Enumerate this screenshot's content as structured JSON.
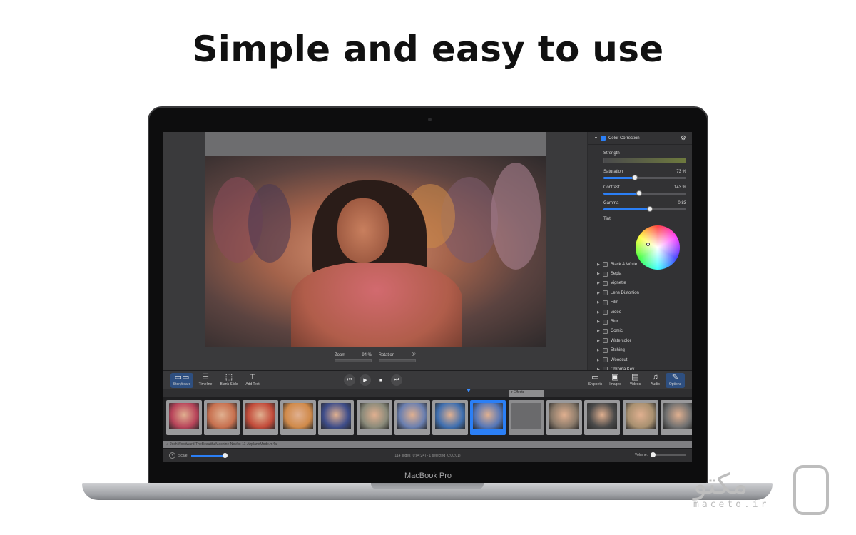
{
  "headline": "Simple and easy to use",
  "device": {
    "brand": "MacBook Pro"
  },
  "preview": {
    "zoom_label": "Zoom",
    "zoom_value": "94 %",
    "rotation_label": "Rotation",
    "rotation_value": "0°"
  },
  "inspector": {
    "title": "Color Correction",
    "strength_label": "Strength",
    "sliders": [
      {
        "label": "Saturation",
        "value": "73 %",
        "level": 0.38
      },
      {
        "label": "Contrast",
        "value": "143 %",
        "level": 0.43
      },
      {
        "label": "Gamma",
        "value": "0,83",
        "level": 0.56
      }
    ],
    "tint_label": "Tint",
    "effects": [
      "Black & White",
      "Sepia",
      "Vignette",
      "Lens Distortion",
      "Film",
      "Video",
      "Blur",
      "Comic",
      "Watercolor",
      "Etching",
      "Woodcut",
      "Chroma Key"
    ]
  },
  "toolbar": {
    "left": [
      {
        "label": "Storyboard",
        "icon": "storyboard-icon"
      },
      {
        "label": "Timeline",
        "icon": "timeline-icon"
      },
      {
        "label": "Blank Slide",
        "icon": "blank-slide-icon"
      },
      {
        "label": "Add Text",
        "icon": "text-icon"
      }
    ],
    "right": [
      {
        "label": "Snippets",
        "icon": "monitor-icon"
      },
      {
        "label": "Images",
        "icon": "image-icon"
      },
      {
        "label": "Videos",
        "icon": "film-icon"
      },
      {
        "label": "Audio",
        "icon": "music-icon"
      },
      {
        "label": "Options",
        "icon": "wrench-icon"
      }
    ]
  },
  "storyboard": {
    "effects_tag": "▾ Effects",
    "audio_track": "♫ JoshWoodward-TheBeautifulMachine-NoVox-11-AirplaneMode.m4a"
  },
  "status": {
    "scale_label": "Scale:",
    "summary": "114 slides (0:04:24) - 1 selected (0:00:01)",
    "volume_label": "Volume:"
  },
  "watermark": {
    "text": "مکتو",
    "url": "maceto.ir"
  }
}
